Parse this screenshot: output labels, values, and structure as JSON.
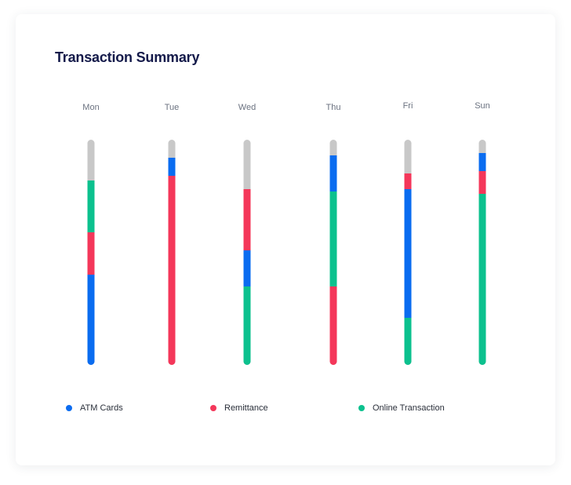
{
  "title": "Transaction Summary",
  "colors": {
    "atm": "#0a6cf0",
    "remittance": "#f4375a",
    "online": "#0cc18e",
    "remainder": "#c8c8c8"
  },
  "legend": [
    {
      "label": "ATM Cards",
      "color": "#0a6cf0"
    },
    {
      "label": "Remittance",
      "color": "#f4375a"
    },
    {
      "label": "Online Transaction",
      "color": "#0cc18e"
    }
  ],
  "chart_data": {
    "type": "bar",
    "stacked": true,
    "orientation": "vertical",
    "categories": [
      "Mon",
      "Tue",
      "Wed",
      "Thu",
      "Fri",
      "Sun"
    ],
    "scale": [
      0,
      100
    ],
    "stack_order_bottom_to_top": "as listed per category",
    "stacks": [
      [
        {
          "series": "ATM Cards",
          "value": 40
        },
        {
          "series": "Remittance",
          "value": 19
        },
        {
          "series": "Online Transaction",
          "value": 23
        }
      ],
      [
        {
          "series": "Remittance",
          "value": 84
        },
        {
          "series": "ATM Cards",
          "value": 8
        }
      ],
      [
        {
          "series": "Online Transaction",
          "value": 35
        },
        {
          "series": "ATM Cards",
          "value": 16
        },
        {
          "series": "Remittance",
          "value": 27
        }
      ],
      [
        {
          "series": "Remittance",
          "value": 35
        },
        {
          "series": "Online Transaction",
          "value": 42
        },
        {
          "series": "ATM Cards",
          "value": 16
        }
      ],
      [
        {
          "series": "Online Transaction",
          "value": 21
        },
        {
          "series": "ATM Cards",
          "value": 57
        },
        {
          "series": "Remittance",
          "value": 7
        }
      ],
      [
        {
          "series": "Online Transaction",
          "value": 76
        },
        {
          "series": "Remittance",
          "value": 10
        },
        {
          "series": "ATM Cards",
          "value": 8
        }
      ]
    ],
    "remainder_color": "#c8c8c8",
    "legend_position": "bottom"
  }
}
